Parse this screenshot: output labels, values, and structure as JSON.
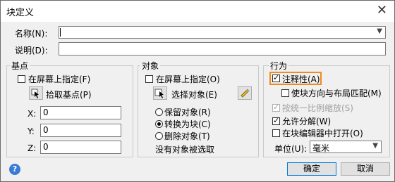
{
  "window": {
    "title": "块定义",
    "close_glyph": "✕"
  },
  "name_label": "名称(N):",
  "name_value": "",
  "desc_label": "说明(D):",
  "desc_value": "",
  "basepoint": {
    "title": "基点",
    "onscreen_label": "在屏幕上指定(F)",
    "onscreen_checked": false,
    "pick_label": "拾取基点(P)",
    "x_label": "X:",
    "x_value": "0",
    "y_label": "Y:",
    "y_value": "0",
    "z_label": "Z:",
    "z_value": "0"
  },
  "objects": {
    "title": "对象",
    "onscreen_label": "在屏幕上指定(O)",
    "onscreen_checked": false,
    "select_label": "选择对象(E)",
    "retain_label": "保留对象(R)",
    "convert_label": "转换为块(C)",
    "delete_label": "删除对象(T)",
    "selected_radio": "convert",
    "status_text": "没有对象被选取"
  },
  "behavior": {
    "title": "行为",
    "annotative_label": "注释性(A)",
    "annotative_checked": true,
    "match_orient_label": "使块方向与布局匹配(M)",
    "match_orient_checked": false,
    "scale_uniform_label": "按统一比例缩放(S)",
    "scale_uniform_checked": true,
    "allow_explode_label": "允许分解(W)",
    "allow_explode_checked": true,
    "open_editor_label": "在块编辑器中打开(O)",
    "open_editor_checked": false,
    "unit_label": "单位(U):",
    "unit_value": "毫米",
    "highlight_color": "#f08a24"
  },
  "buttons": {
    "ok": "确定",
    "cancel": "取消",
    "help_glyph": "?"
  },
  "icons": {
    "pick_point": "pick-point-icon",
    "select_objects": "select-objects-icon",
    "quick_select": "quick-select-icon",
    "help": "help-icon"
  }
}
